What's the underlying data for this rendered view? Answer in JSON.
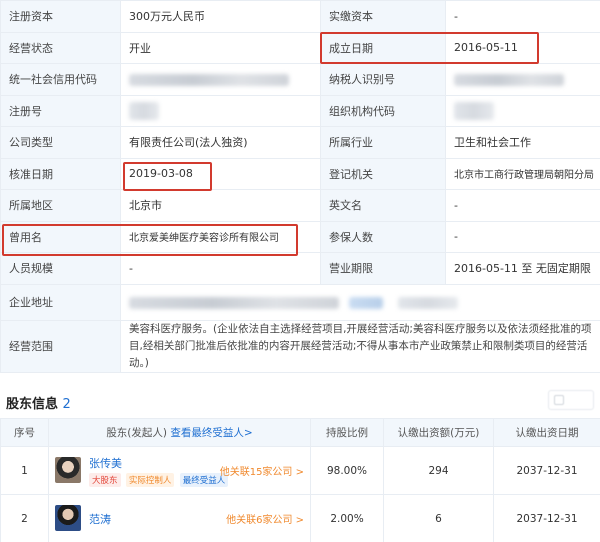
{
  "info": {
    "rows": [
      {
        "k1": "注册资本",
        "v1": "300万元人民币",
        "k2": "实缴资本",
        "v2": "-"
      },
      {
        "k1": "经营状态",
        "v1": "开业",
        "k2": "成立日期",
        "v2": "2016-05-11"
      },
      {
        "k1": "统一社会信用代码",
        "v1": "",
        "k2": "纳税人识别号",
        "v2": ""
      },
      {
        "k1": "注册号",
        "v1": "",
        "k2": "组织机构代码",
        "v2": ""
      },
      {
        "k1": "公司类型",
        "v1": "有限责任公司(法人独资)",
        "k2": "所属行业",
        "v2": "卫生和社会工作"
      },
      {
        "k1": "核准日期",
        "v1": "2019-03-08",
        "k2": "登记机关",
        "v2": "北京市工商行政管理局朝阳分局"
      },
      {
        "k1": "所属地区",
        "v1": "北京市",
        "k2": "英文名",
        "v2": "-"
      },
      {
        "k1": "曾用名",
        "v1": "北京爱美绅医疗美容诊所有限公司",
        "k2": "参保人数",
        "v2": "-"
      },
      {
        "k1": "人员规模",
        "v1": "-",
        "k2": "营业期限",
        "v2": "2016-05-11 至 无固定期限"
      }
    ],
    "address_label": "企业地址",
    "scope_label": "经营范围",
    "scope_text": "美容科医疗服务。(企业依法自主选择经营项目,开展经营活动;美容科医疗服务以及依法须经批准的项目,经相关部门批准后依批准的内容开展经营活动;不得从事本市产业政策禁止和限制类项目的经营活动。)"
  },
  "shareholders": {
    "title": "股东信息",
    "count": "2",
    "headers": {
      "index": "序号",
      "holder": "股东(发起人)",
      "holder_link": "查看最终受益人>",
      "ratio": "持股比例",
      "amount": "认缴出资额(万元)",
      "date": "认缴出资日期"
    },
    "rows": [
      {
        "index": "1",
        "name": "张传美",
        "tags": [
          "大股东",
          "实际控制人",
          "最终受益人"
        ],
        "related": "他关联15家公司 >",
        "ratio": "98.00%",
        "amount": "294",
        "date": "2037-12-31"
      },
      {
        "index": "2",
        "name": "范涛",
        "tags": [],
        "related": "他关联6家公司 >",
        "ratio": "2.00%",
        "amount": "6",
        "date": "2037-12-31"
      }
    ]
  },
  "colors": {
    "highlight": "#d23a2e",
    "link": "#1f6fd1",
    "label_bg": "#f2f7fc"
  }
}
